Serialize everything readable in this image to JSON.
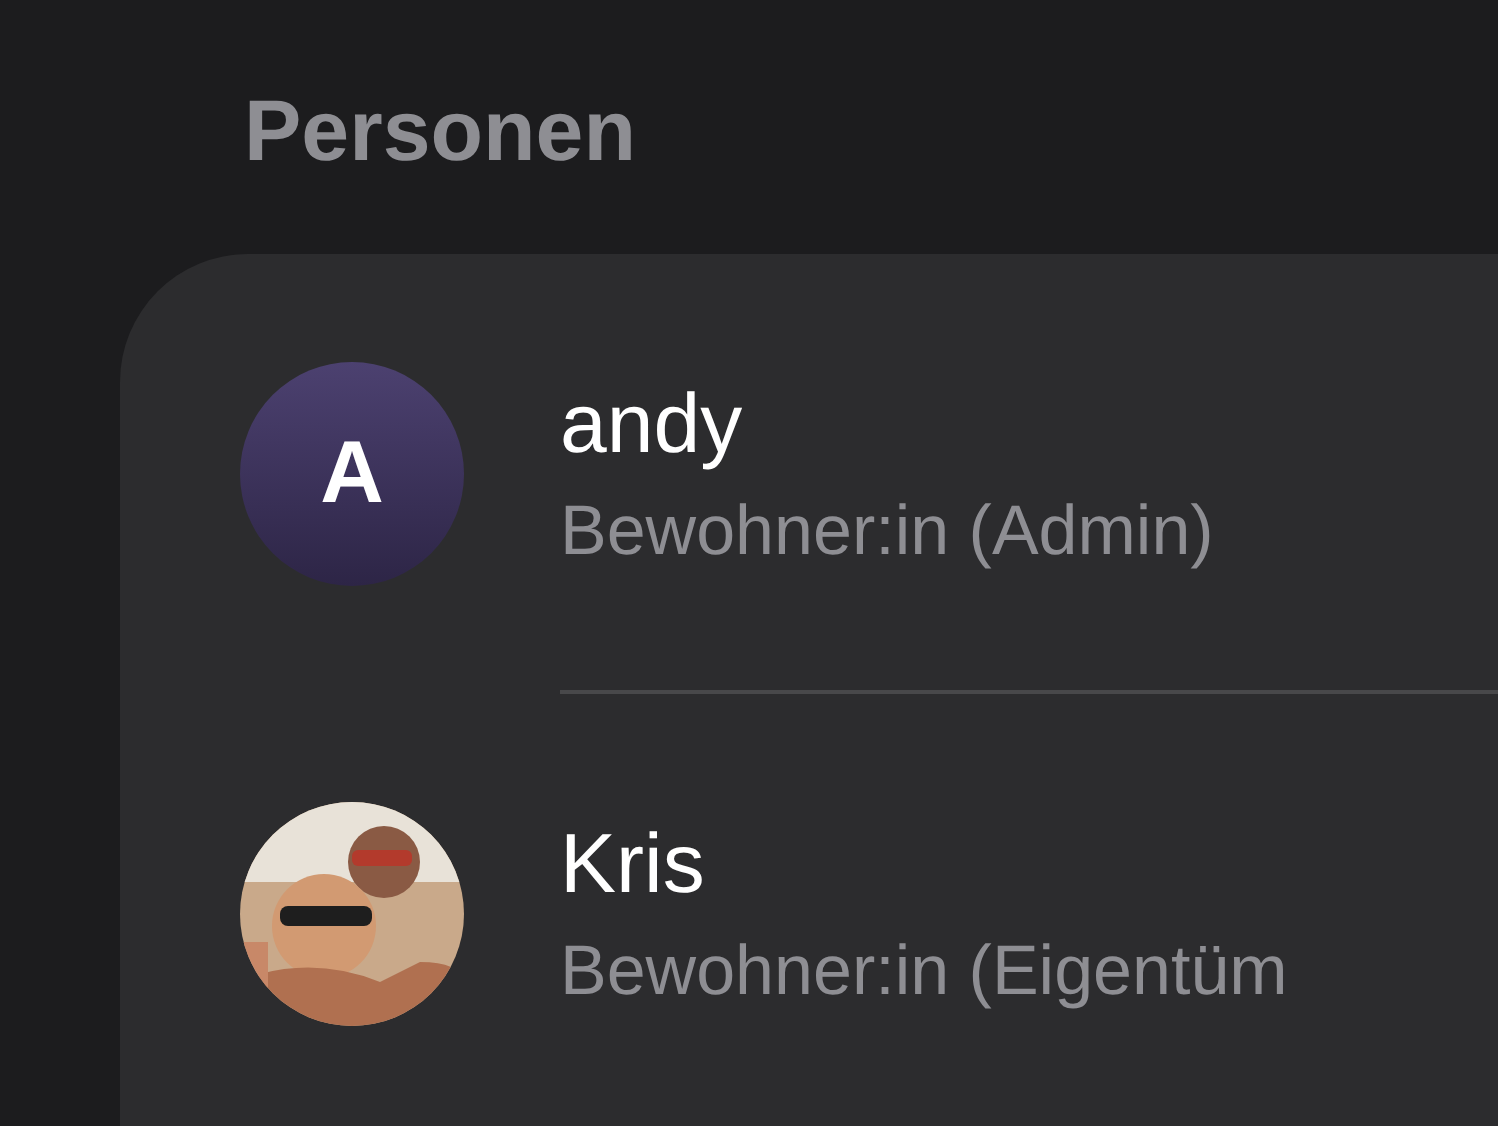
{
  "section_title": "Personen",
  "people": [
    {
      "kind": "initial",
      "initial": "A",
      "name": "andy",
      "role": "Bewohner:in (Admin)"
    },
    {
      "kind": "picture",
      "name": "Kris",
      "role": "Bewohner:in (Eigentüm"
    }
  ]
}
